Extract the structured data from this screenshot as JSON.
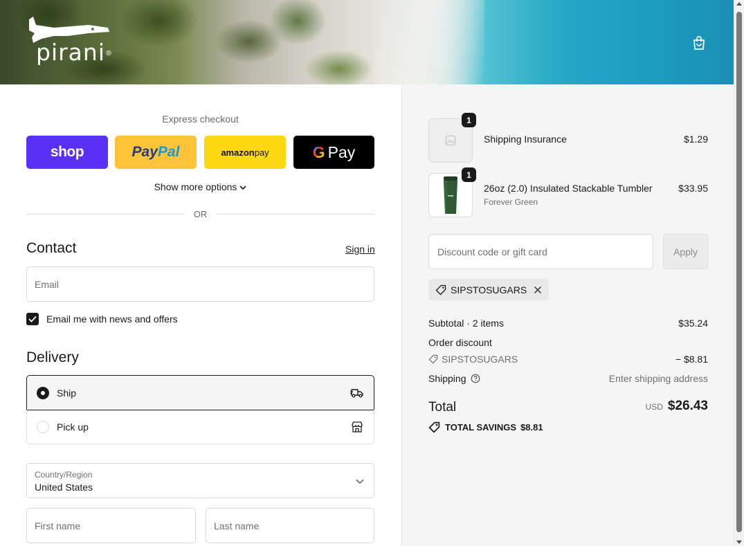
{
  "header": {
    "logo_text": "pirani",
    "logo_mark": "®"
  },
  "express": {
    "label": "Express checkout",
    "shop_label": "shop",
    "paypal_part1": "Pay",
    "paypal_part2": "Pal",
    "amazon_label1": "amazon",
    "amazon_label2": " pay",
    "gpay_g": "G",
    "gpay_label": "Pay",
    "more_options": "Show more options",
    "or": "OR"
  },
  "contact": {
    "title": "Contact",
    "sign_in": "Sign in",
    "email_placeholder": "Email",
    "newsletter_label": "Email me with news and offers"
  },
  "delivery": {
    "title": "Delivery",
    "options": [
      {
        "label": "Ship",
        "selected": true
      },
      {
        "label": "Pick up",
        "selected": false
      }
    ],
    "country_label": "Country/Region",
    "country_value": "United States",
    "first_name_placeholder": "First name",
    "last_name_placeholder": "Last name"
  },
  "cart": {
    "items": [
      {
        "name": "Shipping Insurance",
        "variant": "",
        "quantity": "1",
        "price": "$1.29"
      },
      {
        "name": "26oz (2.0) Insulated Stackable Tumbler",
        "variant": "Forever Green",
        "quantity": "1",
        "price": "$33.95"
      }
    ],
    "discount_placeholder": "Discount code or gift card",
    "apply_label": "Apply",
    "applied_code": "SIPSTOSUGARS"
  },
  "summary": {
    "subtotal_label": "Subtotal · 2 items",
    "subtotal_value": "$35.24",
    "order_discount_label": "Order discount",
    "discount_code": "SIPSTOSUGARS",
    "discount_value": "− $8.81",
    "shipping_label": "Shipping",
    "shipping_value": "Enter shipping address",
    "total_label": "Total",
    "currency": "USD",
    "total_value": "$26.43",
    "savings_label": "TOTAL SAVINGS",
    "savings_value": "$8.81"
  },
  "colors": {
    "shop_purple": "#5a31f4",
    "paypal_yellow": "#ffc439",
    "amazon_yellow": "#ffd814",
    "gpay_black": "#000000",
    "text_dark": "#1a1a1a",
    "summary_bg": "#f5f5f5"
  },
  "icons": [
    "bag-icon",
    "chevron-down-icon",
    "checkmark-icon",
    "truck-icon",
    "store-icon",
    "image-placeholder-icon",
    "tag-icon",
    "close-icon",
    "help-circle-icon"
  ]
}
